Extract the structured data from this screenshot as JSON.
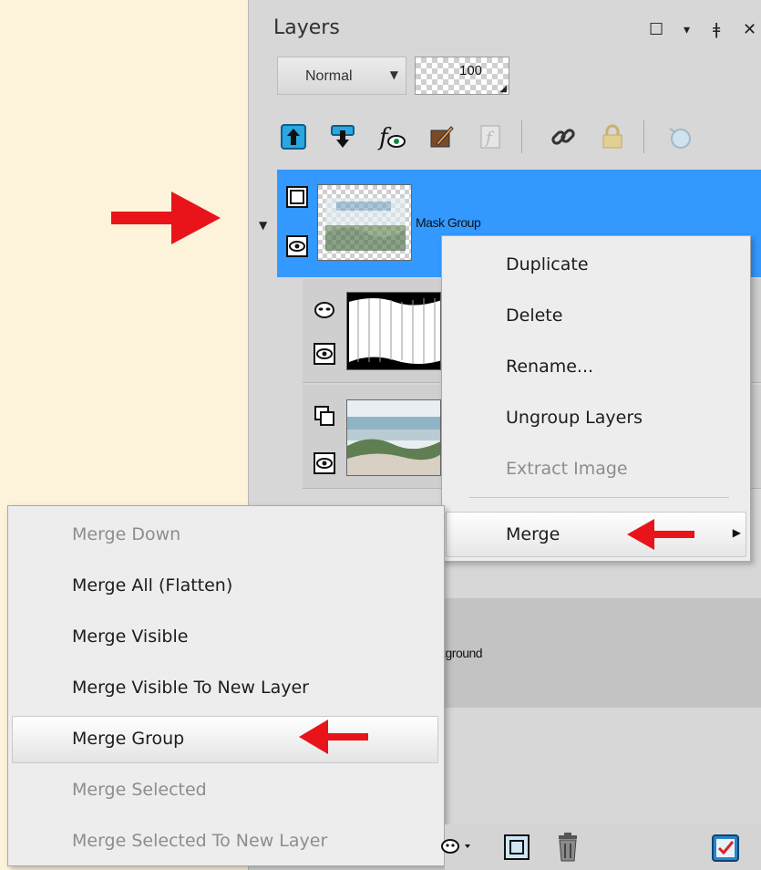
{
  "panel": {
    "title": "Layers",
    "window_controls": [
      {
        "icon": "restore-icon",
        "glyph": "☐"
      },
      {
        "icon": "dropdown-caret-icon",
        "glyph": "▾"
      },
      {
        "icon": "pin-icon",
        "glyph": "ǂ"
      },
      {
        "icon": "close-icon",
        "glyph": "✕"
      }
    ],
    "blend_mode": "Normal",
    "opacity": "100"
  },
  "toolbar": {
    "buttons": [
      {
        "icon": "move-layer-up-icon"
      },
      {
        "icon": "move-layer-down-icon"
      },
      {
        "icon": "layer-effects-icon"
      },
      {
        "icon": "brush-edit-icon"
      },
      {
        "icon": "script-icon-disabled"
      },
      {
        "icon": "link-icon"
      },
      {
        "icon": "lock-icon-disabled"
      },
      {
        "icon": "snapshot-icon-disabled"
      }
    ]
  },
  "layers": {
    "group": {
      "name": "Mask Group",
      "icons": [
        "group-icon",
        "eye-icon"
      ]
    },
    "children": [
      {
        "name": "",
        "icons": [
          "mask-icon",
          "eye-icon"
        ]
      },
      {
        "name": "",
        "icons": [
          "raster-layer-icon",
          "eye-icon"
        ]
      }
    ],
    "background": {
      "name_partial": "kground"
    }
  },
  "context_menu": {
    "items": [
      {
        "label": "Duplicate",
        "enabled": true
      },
      {
        "label": "Delete",
        "enabled": true
      },
      {
        "label": "Rename...",
        "enabled": true
      },
      {
        "label": "Ungroup Layers",
        "enabled": true
      },
      {
        "label": "Extract Image",
        "enabled": false
      },
      {
        "label": "Merge",
        "enabled": true,
        "submenu": true
      }
    ]
  },
  "merge_submenu": {
    "items": [
      {
        "label": "Merge Down",
        "enabled": false
      },
      {
        "label": "Merge All (Flatten)",
        "enabled": true
      },
      {
        "label": "Merge Visible",
        "enabled": true
      },
      {
        "label": "Merge Visible To New Layer",
        "enabled": true
      },
      {
        "label": "Merge Group",
        "enabled": true,
        "highlighted": true
      },
      {
        "label": "Merge Selected",
        "enabled": false
      },
      {
        "label": "Merge Selected To New Layer",
        "enabled": false
      }
    ]
  },
  "bottom_toolbar": {
    "buttons": [
      {
        "icon": "mask-dropdown-icon"
      },
      {
        "icon": "new-group-icon"
      },
      {
        "icon": "trash-icon"
      },
      {
        "icon": "properties-check-icon"
      }
    ]
  },
  "annotation_color": "#e8141a",
  "selection_color": "#3399ff"
}
